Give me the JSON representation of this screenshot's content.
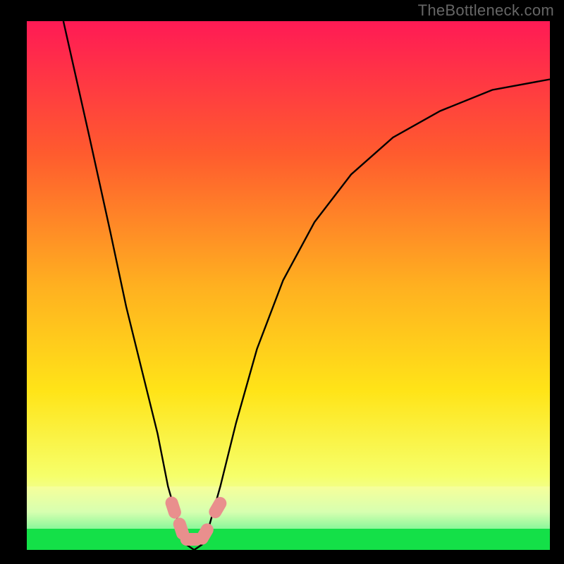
{
  "watermark": "TheBottleneck.com",
  "chart_data": {
    "type": "line",
    "title": "",
    "xlabel": "",
    "ylabel": "",
    "xlim": [
      0,
      100
    ],
    "ylim": [
      0,
      100
    ],
    "grid": false,
    "legend": false,
    "series": [
      {
        "name": "bottleneck-curve",
        "x": [
          7,
          12,
          16,
          19,
          22,
          25,
          27,
          29,
          30.5,
          32,
          33.5,
          35,
          37,
          40,
          44,
          49,
          55,
          62,
          70,
          79,
          89,
          100
        ],
        "y": [
          100,
          78,
          60,
          46,
          34,
          22,
          12,
          5,
          1,
          0,
          1,
          5,
          12,
          24,
          38,
          51,
          62,
          71,
          78,
          83,
          87,
          89
        ]
      }
    ],
    "annotations": [
      {
        "type": "band",
        "name": "green-band",
        "y0": 0,
        "y1": 4,
        "color": "#14e048"
      },
      {
        "type": "band",
        "name": "pale-band",
        "y0": 4,
        "y1": 12,
        "color": "pale-green-yellow"
      },
      {
        "type": "marker",
        "x": 28.0,
        "y": 8
      },
      {
        "type": "marker",
        "x": 29.5,
        "y": 4
      },
      {
        "type": "marker",
        "x": 31.5,
        "y": 2
      },
      {
        "type": "marker",
        "x": 34.0,
        "y": 3
      },
      {
        "type": "marker",
        "x": 36.5,
        "y": 8
      }
    ],
    "gradient_stops": [
      {
        "pos": 0.0,
        "color": "#ff1a55"
      },
      {
        "pos": 0.25,
        "color": "#ff5b2e"
      },
      {
        "pos": 0.5,
        "color": "#ffb020"
      },
      {
        "pos": 0.7,
        "color": "#ffe418"
      },
      {
        "pos": 0.86,
        "color": "#f6ff6a"
      },
      {
        "pos": 0.92,
        "color": "#ecffb4"
      },
      {
        "pos": 0.97,
        "color": "#9ef7a4"
      },
      {
        "pos": 1.0,
        "color": "#14e048"
      }
    ],
    "markers_color": "#e98f8d"
  },
  "colors": {
    "frame": "#000000",
    "curve": "#000000",
    "watermark": "#666666"
  }
}
